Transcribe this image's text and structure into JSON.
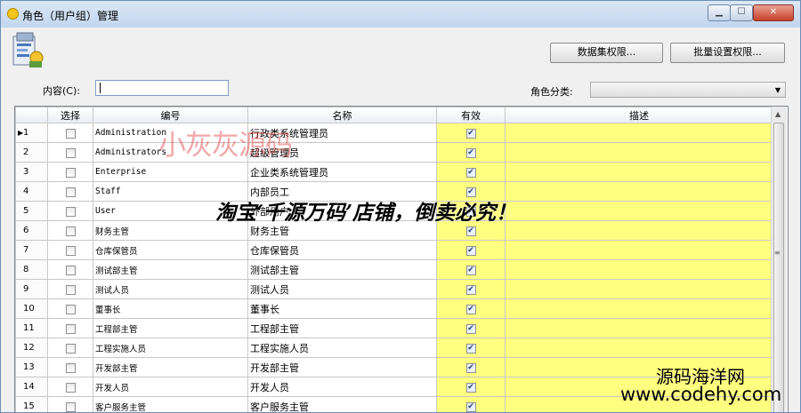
{
  "window": {
    "title": "角色（用户组）管理",
    "min_glyph": "▁",
    "max_glyph": "☐",
    "close_glyph": "✕"
  },
  "toolbar": {
    "dataset_permission_label": "数据集权限...",
    "batch_permission_label": "批量设置权限..."
  },
  "filter": {
    "content_label": "内容(C):",
    "content_value": "",
    "category_label": "角色分类:",
    "category_value": ""
  },
  "grid": {
    "columns": {
      "select": "选择",
      "code": "编号",
      "name": "名称",
      "valid": "有效",
      "desc": "描述"
    },
    "rows": [
      {
        "num": "1",
        "selected": false,
        "code": "Administration",
        "name": "行政类系统管理员",
        "valid": true,
        "desc": ""
      },
      {
        "num": "2",
        "selected": false,
        "code": "Administrators",
        "name": "超级管理员",
        "valid": true,
        "desc": ""
      },
      {
        "num": "3",
        "selected": false,
        "code": "Enterprise",
        "name": "企业类系统管理员",
        "valid": true,
        "desc": ""
      },
      {
        "num": "4",
        "selected": false,
        "code": "Staff",
        "name": "内部员工",
        "valid": true,
        "desc": ""
      },
      {
        "num": "5",
        "selected": false,
        "code": "User",
        "name": "外部用户",
        "valid": true,
        "desc": ""
      },
      {
        "num": "6",
        "selected": false,
        "code": "财务主管",
        "name": "财务主管",
        "valid": true,
        "desc": ""
      },
      {
        "num": "7",
        "selected": false,
        "code": "仓库保管员",
        "name": "仓库保管员",
        "valid": true,
        "desc": ""
      },
      {
        "num": "8",
        "selected": false,
        "code": "测试部主管",
        "name": "测试部主管",
        "valid": true,
        "desc": ""
      },
      {
        "num": "9",
        "selected": false,
        "code": "测试人员",
        "name": "测试人员",
        "valid": true,
        "desc": ""
      },
      {
        "num": "10",
        "selected": false,
        "code": "董事长",
        "name": "董事长",
        "valid": true,
        "desc": ""
      },
      {
        "num": "11",
        "selected": false,
        "code": "工程部主管",
        "name": "工程部主管",
        "valid": true,
        "desc": ""
      },
      {
        "num": "12",
        "selected": false,
        "code": "工程实施人员",
        "name": "工程实施人员",
        "valid": true,
        "desc": ""
      },
      {
        "num": "13",
        "selected": false,
        "code": "开发部主管",
        "name": "开发部主管",
        "valid": true,
        "desc": ""
      },
      {
        "num": "14",
        "selected": false,
        "code": "开发人员",
        "name": "开发人员",
        "valid": true,
        "desc": ""
      },
      {
        "num": "15",
        "selected": false,
        "code": "客户服务主管",
        "name": "客户服务主管",
        "valid": true,
        "desc": ""
      }
    ]
  },
  "watermarks": {
    "red_overlay": "小灰灰源码",
    "notice": "淘宝‘千源万码’店铺，倒卖必究！",
    "site_name": "源码海洋网",
    "site_url": "www.codehy.com"
  },
  "colors": {
    "yellow_cells": "#ffff80",
    "title_bar": "#c2d6ee",
    "close_button": "#c6412c"
  }
}
